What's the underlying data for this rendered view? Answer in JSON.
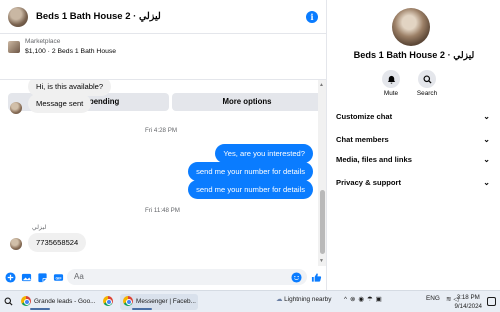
{
  "chat": {
    "title": "Beds 1 Bath House 2 · ليزلي",
    "listing": {
      "kicker": "Marketplace",
      "description": "$1,100 · 2 Beds 1 Bath House"
    },
    "buttons": {
      "pending": "Mark as pending",
      "more": "More options"
    },
    "messages": {
      "partial_in": "Hi, is this available?",
      "sent_in": "Message sent",
      "ts1": "Fri 4:28 PM",
      "out1": "Yes, are you interested?",
      "out2": "send me your number for details",
      "out3": "send me your number for details",
      "ts2": "Fri 11:48 PM",
      "sender": "ليزلي",
      "in_number": "7735658524"
    },
    "composer": {
      "placeholder": "Aa"
    }
  },
  "details": {
    "name": "Beds 1 Bath House 2 · ليزلي",
    "actions": {
      "mute": "Mute",
      "search": "Search"
    },
    "sections": [
      "Customize chat",
      "Chat members",
      "Media, files and links",
      "Privacy & support"
    ]
  },
  "taskbar": {
    "apps": {
      "grande": "Grande leads - Goo...",
      "messenger": "Messenger | Faceb..."
    },
    "weather": "Lightning nearby",
    "lang": "ENG",
    "time": "3:18 PM",
    "date": "9/14/2024"
  },
  "colors": {
    "accent": "#0a7cff",
    "bubble_in": "#f0f0f0",
    "button_bg": "#e4e6eb"
  }
}
